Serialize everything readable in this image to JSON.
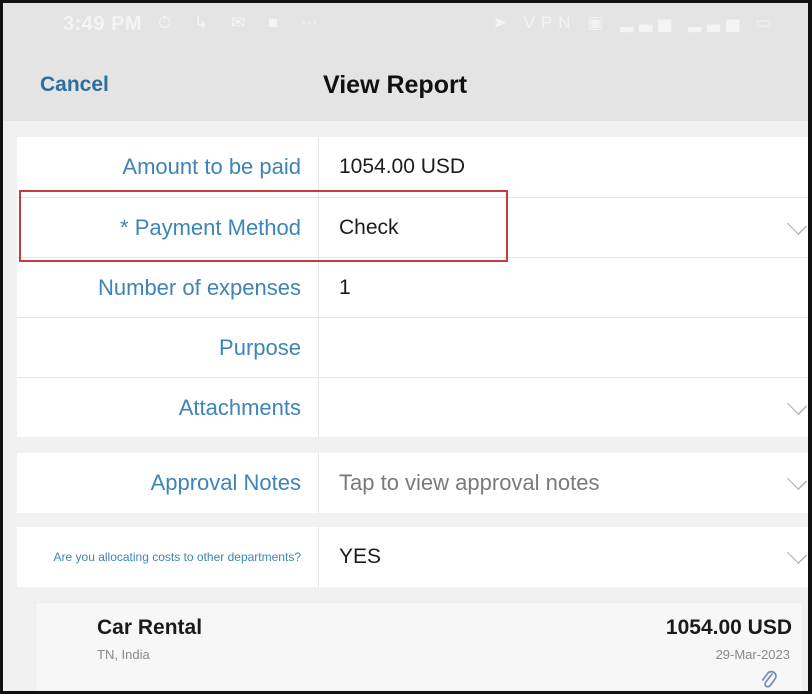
{
  "status_bar": {
    "time": "3:49 PM",
    "left_icons": [
      "alarm-icon",
      "missed-call-icon",
      "message-icon",
      "chat-icon",
      "more-icon"
    ],
    "left_glyphs": "⏱ ↳ ✉ ■ ⋯",
    "right_icons": [
      "location-icon",
      "vpn-icon",
      "data-icon",
      "signal-icon",
      "signal-icon",
      "battery-icon"
    ],
    "right_glyphs": "➤ VPN ▣ ▂▃▅ ▂▃▅ ▭"
  },
  "header": {
    "cancel_label": "Cancel",
    "title": "View Report"
  },
  "form": {
    "amount": {
      "label": "Amount to be paid",
      "value": "1054.00 USD"
    },
    "payment_method": {
      "label": "* Payment Method",
      "value": "Check"
    },
    "expenses": {
      "label": "Number of expenses",
      "value": "1"
    },
    "purpose": {
      "label": "Purpose",
      "value": ""
    },
    "attachments": {
      "label": "Attachments",
      "value": ""
    },
    "approval_notes": {
      "label": "Approval Notes",
      "value": "Tap to view approval notes"
    },
    "allocating": {
      "label": "Are you allocating costs to other departments?",
      "value": "YES"
    }
  },
  "expense_card": {
    "name": "Car Rental",
    "location": "TN, India",
    "amount": "1054.00 USD",
    "date": "29-Mar-2023",
    "attachment_icon": "paperclip-icon"
  },
  "colors": {
    "accent": "#3e84b6",
    "highlight": "#c73b3b",
    "header_bg": "#e4e4e4"
  }
}
